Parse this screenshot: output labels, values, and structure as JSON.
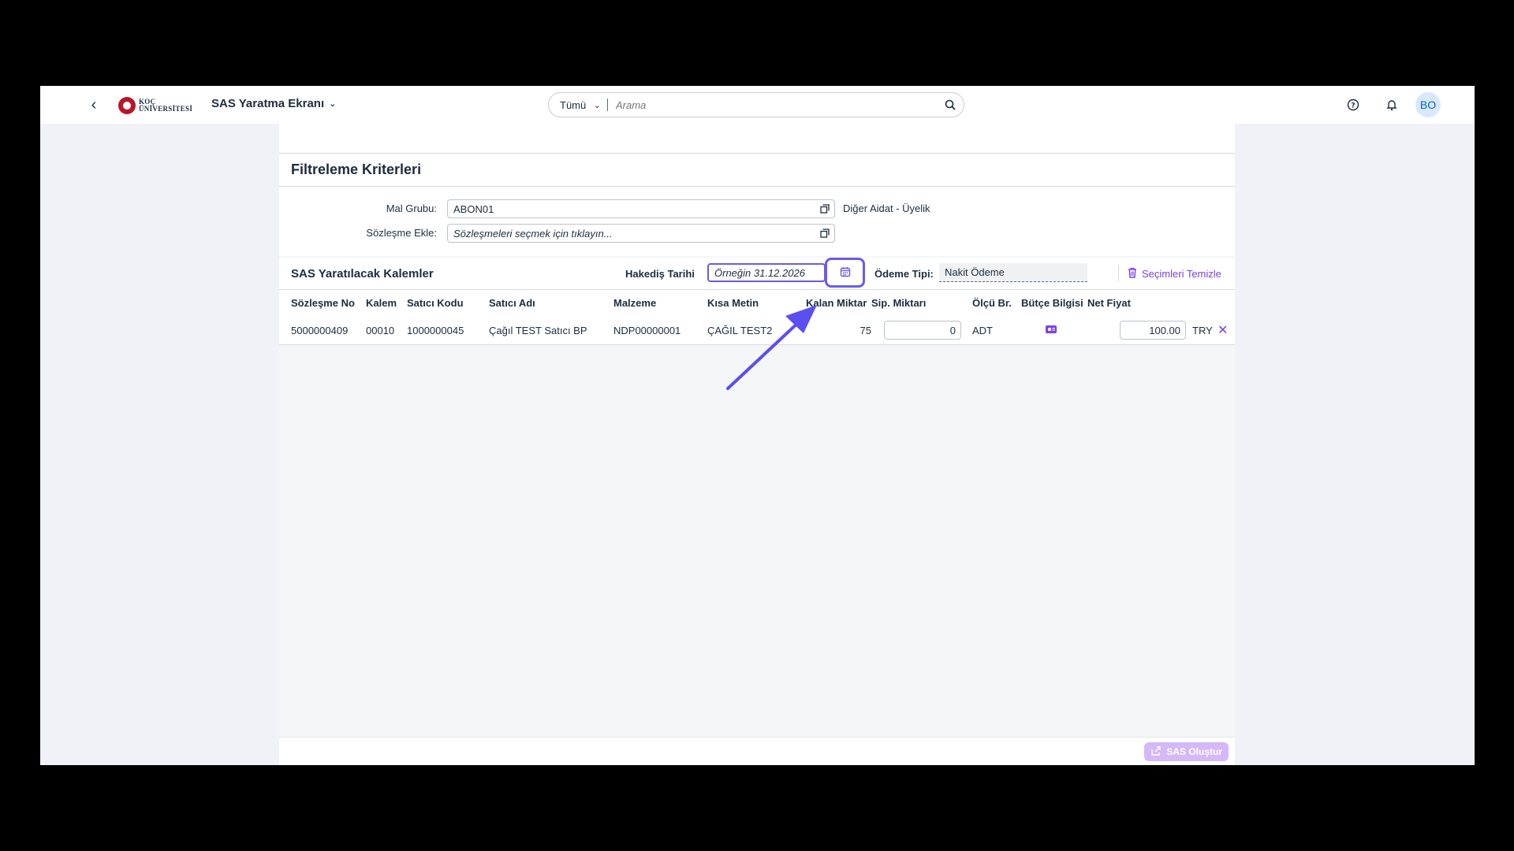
{
  "shell": {
    "app_title": "SAS Yaratma Ekranı",
    "logo_line1": "KOÇ",
    "logo_line2": "ÜNİVERSİTESİ",
    "search_scope": "Tümü",
    "search_placeholder": "Arama",
    "avatar_initials": "BO"
  },
  "filter_section": {
    "title": "Filtreleme Kriterleri",
    "mal_grubu": {
      "label": "Mal Grubu:",
      "value": "ABON01",
      "description": "Diğer Aidat - Üyelik"
    },
    "sozlesme_ekle": {
      "label": "Sözleşme Ekle:",
      "placeholder": "Sözleşmeleri seçmek için tıklayın..."
    }
  },
  "items_section": {
    "title": "SAS Yaratılacak Kalemler",
    "hakedis_label": "Hakediş Tarihi",
    "hakedis_placeholder": "Örneğin 31.12.2026",
    "odeme_label": "Ödeme Tipi:",
    "odeme_value": "Nakit Ödeme",
    "clear_label": "Seçimleri Temizle"
  },
  "table": {
    "columns": [
      "Sözleşme No",
      "Kalem",
      "Satıcı Kodu",
      "Satıcı Adı",
      "Malzeme",
      "Kısa Metin",
      "Kalan Miktar",
      "Sip. Miktarı",
      "Ölçü Br.",
      "Bütçe Bilgisi",
      "Net Fiyat"
    ],
    "rows": [
      {
        "sozlesme_no": "5000000409",
        "kalem": "00010",
        "satici_kodu": "1000000045",
        "satici_adi": "Çağıl TEST Satıcı BP",
        "malzeme": "NDP00000001",
        "kisa_metin": "ÇAĞIL TEST2",
        "kalan_miktar": "75",
        "sip_miktari": "0",
        "olcu_br": "ADT",
        "net_fiyat": "100.00",
        "currency": "TRY"
      }
    ]
  },
  "footer": {
    "create_label": "SAS Oluştur"
  },
  "colors": {
    "accent": "#7b40e8",
    "highlight": "#6c5ce7",
    "arrow": "#5b4ff0"
  }
}
